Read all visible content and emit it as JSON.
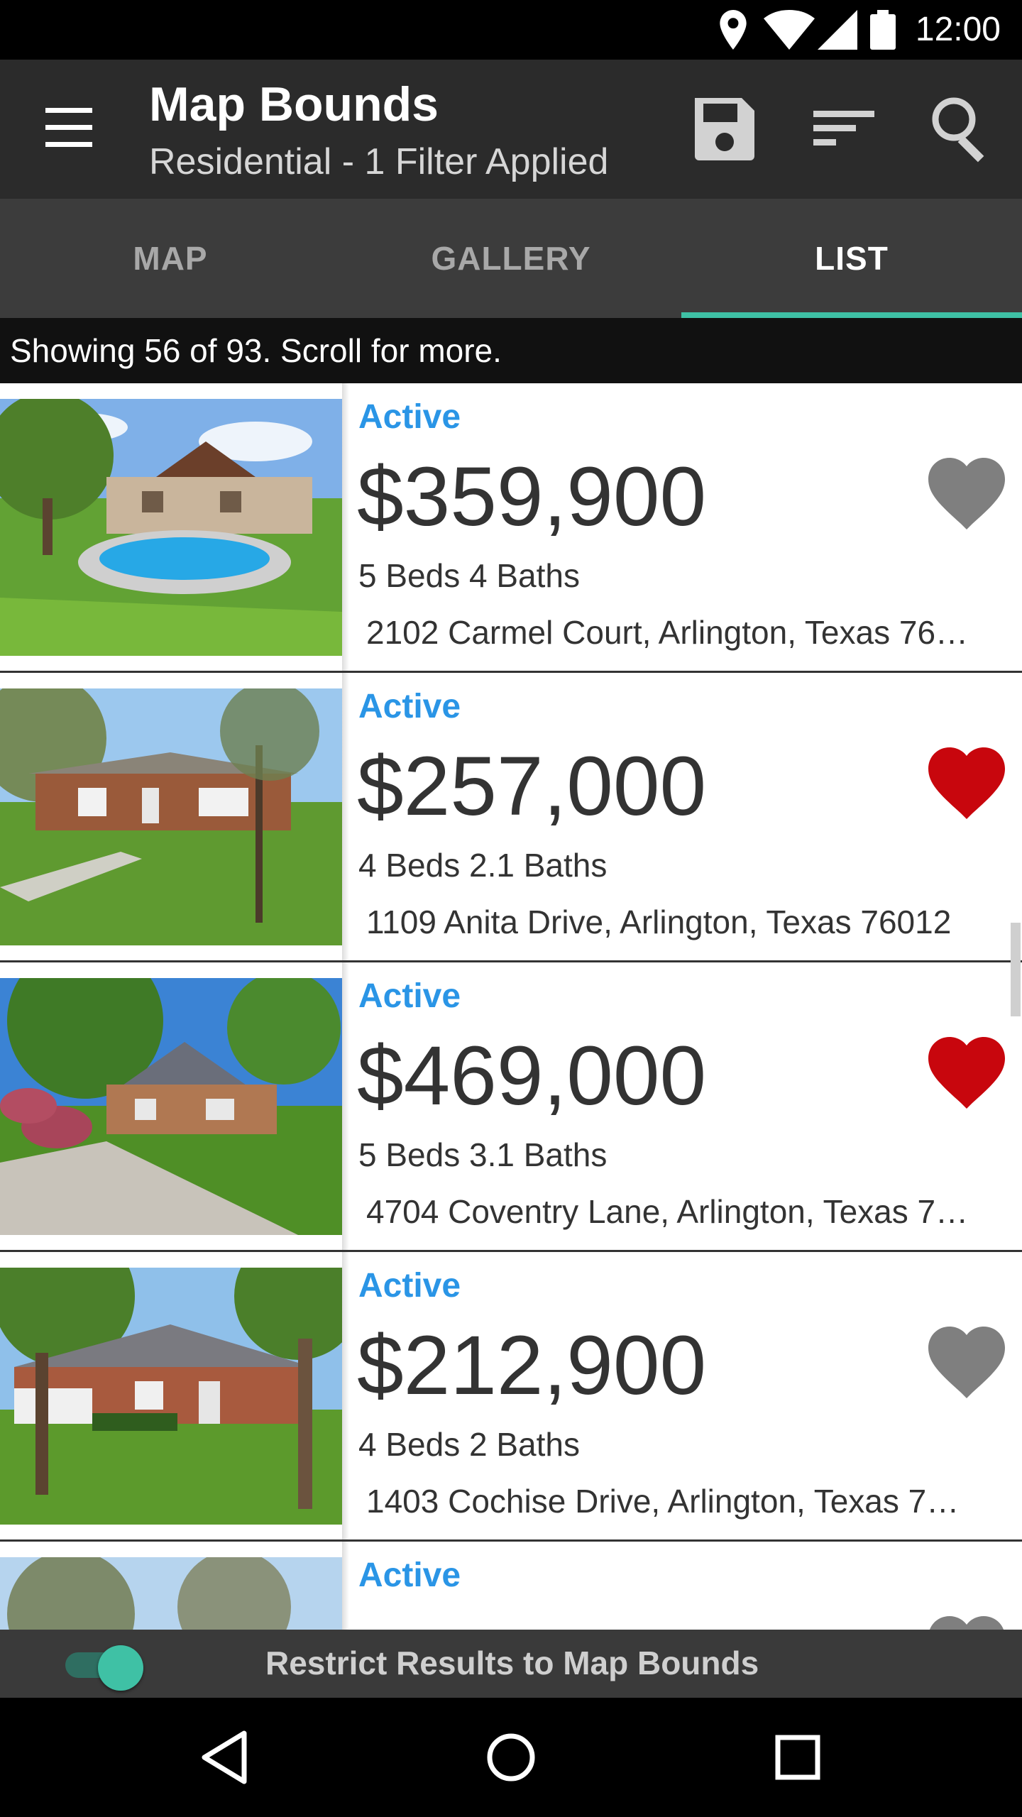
{
  "status_bar": {
    "time": "12:00"
  },
  "app_bar": {
    "title": "Map Bounds",
    "subtitle": "Residential - 1 Filter Applied"
  },
  "tabs": [
    {
      "label": "MAP",
      "active": false
    },
    {
      "label": "GALLERY",
      "active": false
    },
    {
      "label": "LIST",
      "active": true
    }
  ],
  "info_bar": {
    "text": "Showing 56 of 93. Scroll for more."
  },
  "listings": [
    {
      "status": "Active",
      "price": "$359,900",
      "beds_baths": "5 Beds 4 Baths",
      "address": "2102 Carmel Court, Arlington, Texas 76…",
      "favorited": false
    },
    {
      "status": "Active",
      "price": "$257,000",
      "beds_baths": "4 Beds 2.1 Baths",
      "address": "1109 Anita Drive, Arlington, Texas 76012",
      "favorited": true
    },
    {
      "status": "Active",
      "price": "$469,000",
      "beds_baths": "5 Beds 3.1 Baths",
      "address": "4704 Coventry Lane, Arlington, Texas 7…",
      "favorited": true
    },
    {
      "status": "Active",
      "price": "$212,900",
      "beds_baths": "4 Beds 2 Baths",
      "address": "1403 Cochise Drive, Arlington, Texas 7…",
      "favorited": false
    },
    {
      "status": "Active",
      "price": "",
      "beds_baths": "",
      "address": "",
      "favorited": false
    }
  ],
  "bottom_bar": {
    "label": "Restrict Results to Map Bounds",
    "toggle_on": true
  },
  "colors": {
    "accent": "#3fc1a5",
    "status_active": "#2a95e6",
    "heart_favorited": "#c8060d",
    "heart_unfavorited": "#7f7f7f",
    "app_bar": "#2b2b2b",
    "tab_bar": "#3c3c3c"
  },
  "icons": {
    "menu": "menu-icon",
    "save": "save-icon",
    "sort": "sort-icon",
    "search": "search-icon",
    "heart": "heart-icon"
  }
}
